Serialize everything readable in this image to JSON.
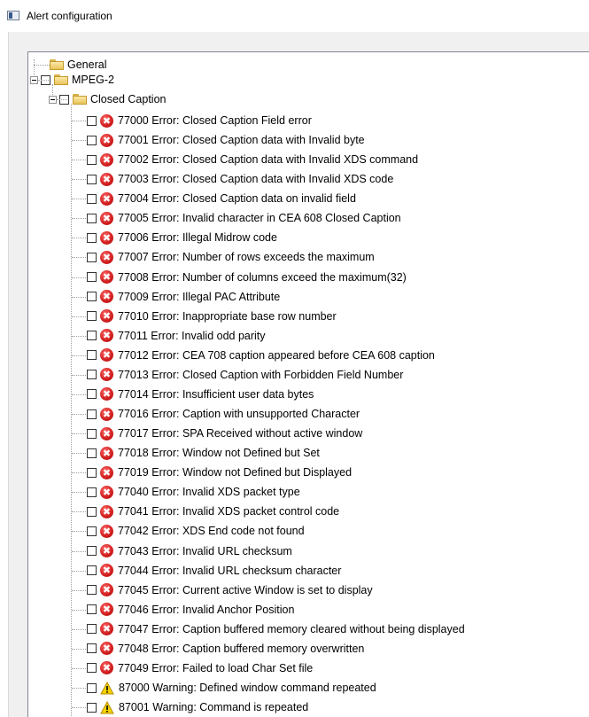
{
  "window": {
    "title": "Alert configuration"
  },
  "tree": {
    "general": "General",
    "mpeg2": "MPEG-2",
    "closed_caption": "Closed Caption",
    "items": [
      {
        "type": "error",
        "label": "77000 Error: Closed Caption Field error"
      },
      {
        "type": "error",
        "label": "77001 Error: Closed Caption data with Invalid byte"
      },
      {
        "type": "error",
        "label": "77002 Error: Closed Caption data with Invalid XDS command"
      },
      {
        "type": "error",
        "label": "77003 Error: Closed Caption data with Invalid XDS code"
      },
      {
        "type": "error",
        "label": "77004 Error: Closed Caption data on invalid field"
      },
      {
        "type": "error",
        "label": "77005 Error: Invalid character in CEA 608 Closed Caption"
      },
      {
        "type": "error",
        "label": "77006 Error: Illegal Midrow code"
      },
      {
        "type": "error",
        "label": "77007 Error: Number of rows exceeds the maximum"
      },
      {
        "type": "error",
        "label": "77008 Error: Number of columns exceed the maximum(32)"
      },
      {
        "type": "error",
        "label": "77009 Error: Illegal PAC Attribute"
      },
      {
        "type": "error",
        "label": "77010 Error: Inappropriate base row number"
      },
      {
        "type": "error",
        "label": "77011 Error: Invalid odd parity"
      },
      {
        "type": "error",
        "label": "77012 Error: CEA 708 caption appeared before CEA 608 caption"
      },
      {
        "type": "error",
        "label": "77013 Error: Closed Caption with Forbidden Field Number"
      },
      {
        "type": "error",
        "label": "77014 Error: Insufficient user data bytes"
      },
      {
        "type": "error",
        "label": "77016 Error: Caption with unsupported Character"
      },
      {
        "type": "error",
        "label": "77017 Error: SPA Received without active window"
      },
      {
        "type": "error",
        "label": "77018 Error: Window not Defined but Set"
      },
      {
        "type": "error",
        "label": "77019 Error: Window not Defined but Displayed"
      },
      {
        "type": "error",
        "label": "77040 Error: Invalid XDS packet type"
      },
      {
        "type": "error",
        "label": "77041 Error: Invalid XDS packet control code"
      },
      {
        "type": "error",
        "label": "77042 Error: XDS End code not found"
      },
      {
        "type": "error",
        "label": "77043 Error: Invalid URL checksum"
      },
      {
        "type": "error",
        "label": "77044 Error: Invalid URL checksum character"
      },
      {
        "type": "error",
        "label": "77045 Error: Current active Window is set to display"
      },
      {
        "type": "error",
        "label": "77046 Error: Invalid Anchor Position"
      },
      {
        "type": "error",
        "label": "77047 Error: Caption buffered memory cleared without being displayed"
      },
      {
        "type": "error",
        "label": "77048 Error: Caption buffered memory overwritten"
      },
      {
        "type": "error",
        "label": "77049 Error: Failed to load Char Set file"
      },
      {
        "type": "warning",
        "label": "87000 Warning: Defined window command repeated"
      },
      {
        "type": "warning",
        "label": "87001 Warning: Command is repeated"
      }
    ]
  }
}
